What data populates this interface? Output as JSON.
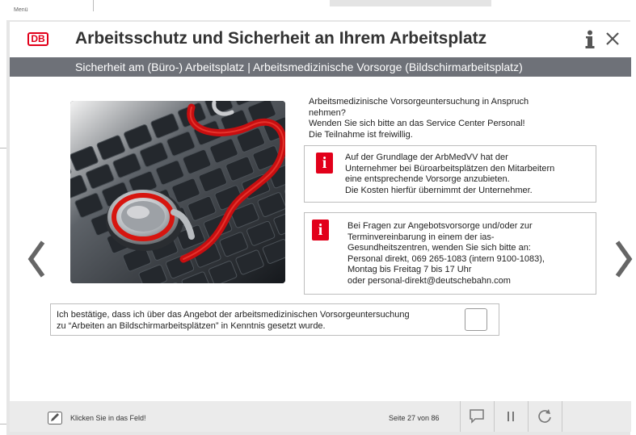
{
  "window": {
    "menu_label": "Menü"
  },
  "header": {
    "logo_text": "DB",
    "title": "Arbeitsschutz und Sicherheit an Ihrem Arbeitsplatz",
    "subtitle": "Sicherheit am (Büro-) Arbeitsplatz | Arbeitsmedizinische Vorsorge (Bildschirmarbeitsplatz)"
  },
  "content": {
    "intro_lines": [
      "Arbeitsmedizinische Vorsorgeuntersuchung in Anspruch",
      "nehmen?",
      "Wenden Sie sich bitte an das Service Center Personal!",
      "Die Teilnahme ist freiwillig."
    ],
    "info_box_1": {
      "lines": [
        "Auf der Grundlage der ArbMedVV  hat der",
        "Unternehmer bei Büroarbeitsplätzen den Mitarbeitern",
        "eine entsprechende Vorsorge anzubieten.",
        "Die Kosten hierfür übernimmt der Unternehmer."
      ]
    },
    "info_box_2": {
      "lines": [
        "Bei Fragen zur Angebotsvorsorge und/oder zur",
        "Terminvereinbarung in einem der ias-",
        "Gesundheitszentren, wenden Sie sich bitte an:",
        "Personal direkt, 069 265-1083 (intern 9100-1083),",
        "Montag bis Freitag 7 bis 17 Uhr",
        "oder personal-direkt@deutschebahn.com"
      ]
    },
    "info_glyph": "i",
    "confirm": {
      "lines": [
        "Ich bestätige, dass ich über das Angebot der arbeitsmedizinischen Vorsorgeuntersuchung",
        "zu “Arbeiten an Bildschirmarbeitsplätzen” in Kenntnis gesetzt wurde."
      ],
      "checked": false
    }
  },
  "footer": {
    "hint": "Klicken Sie in das Feld!",
    "page_info": "Seite 27 von 86"
  },
  "colors": {
    "brand_red": "#e2001a",
    "subheader_gray": "#6e7178",
    "footer_bg": "#ebebeb"
  },
  "icons": [
    "info-icon",
    "close-icon",
    "chevron-left-icon",
    "chevron-right-icon",
    "pencil-icon",
    "comment-icon",
    "pause-icon",
    "refresh-icon"
  ]
}
